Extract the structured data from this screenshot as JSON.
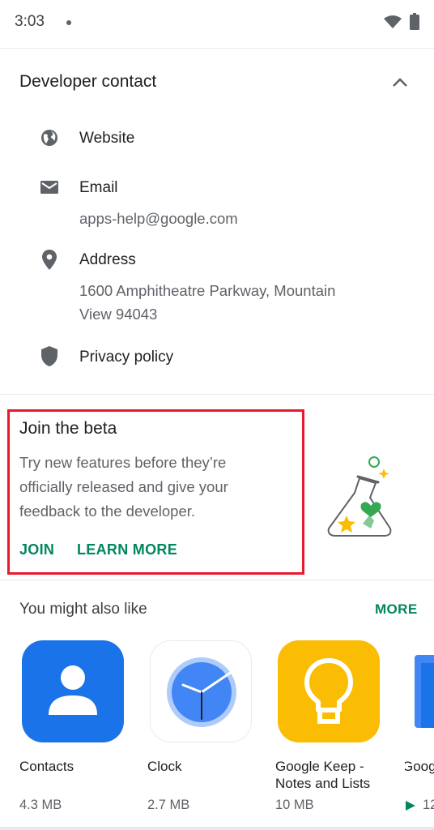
{
  "status_bar": {
    "time": "3:03"
  },
  "developer_contact": {
    "title": "Developer contact",
    "items": [
      {
        "label": "Website",
        "icon": "globe-icon"
      },
      {
        "label": "Email",
        "value": "apps-help@google.com",
        "icon": "mail-icon"
      },
      {
        "label": "Address",
        "value_line1": "1600 Amphitheatre Parkway, Mountain",
        "value_line2": "View 94043",
        "icon": "location-pin-icon"
      },
      {
        "label": "Privacy policy",
        "icon": "shield-icon"
      }
    ]
  },
  "beta": {
    "title": "Join the beta",
    "description_line1": "Try new features before they’re",
    "description_line2": "officially released and give your",
    "description_line3": "feedback to the developer.",
    "join_label": "JOIN",
    "learn_more_label": "LEARN MORE",
    "highlight_color": "#e8192c"
  },
  "suggestions": {
    "title": "You might also like",
    "more_label": "MORE",
    "apps": [
      {
        "name": "Contacts",
        "size": "4.3 MB",
        "icon": "contacts-app-icon",
        "color": "#1a73e8"
      },
      {
        "name": "Clock",
        "size": "2.7 MB",
        "icon": "clock-app-icon",
        "color": "#4285f4"
      },
      {
        "name_line1": "Google Keep -",
        "name_line2": "Notes and Lists",
        "size": "10 MB",
        "icon": "keep-app-icon",
        "color": "#fbbc04"
      },
      {
        "name": "Goog",
        "size": "12",
        "icon": "google-app-icon",
        "color": "#4285f4"
      }
    ]
  },
  "colors": {
    "accent_green": "#01875f",
    "text_primary": "#202124",
    "text_secondary": "#5f6368"
  }
}
